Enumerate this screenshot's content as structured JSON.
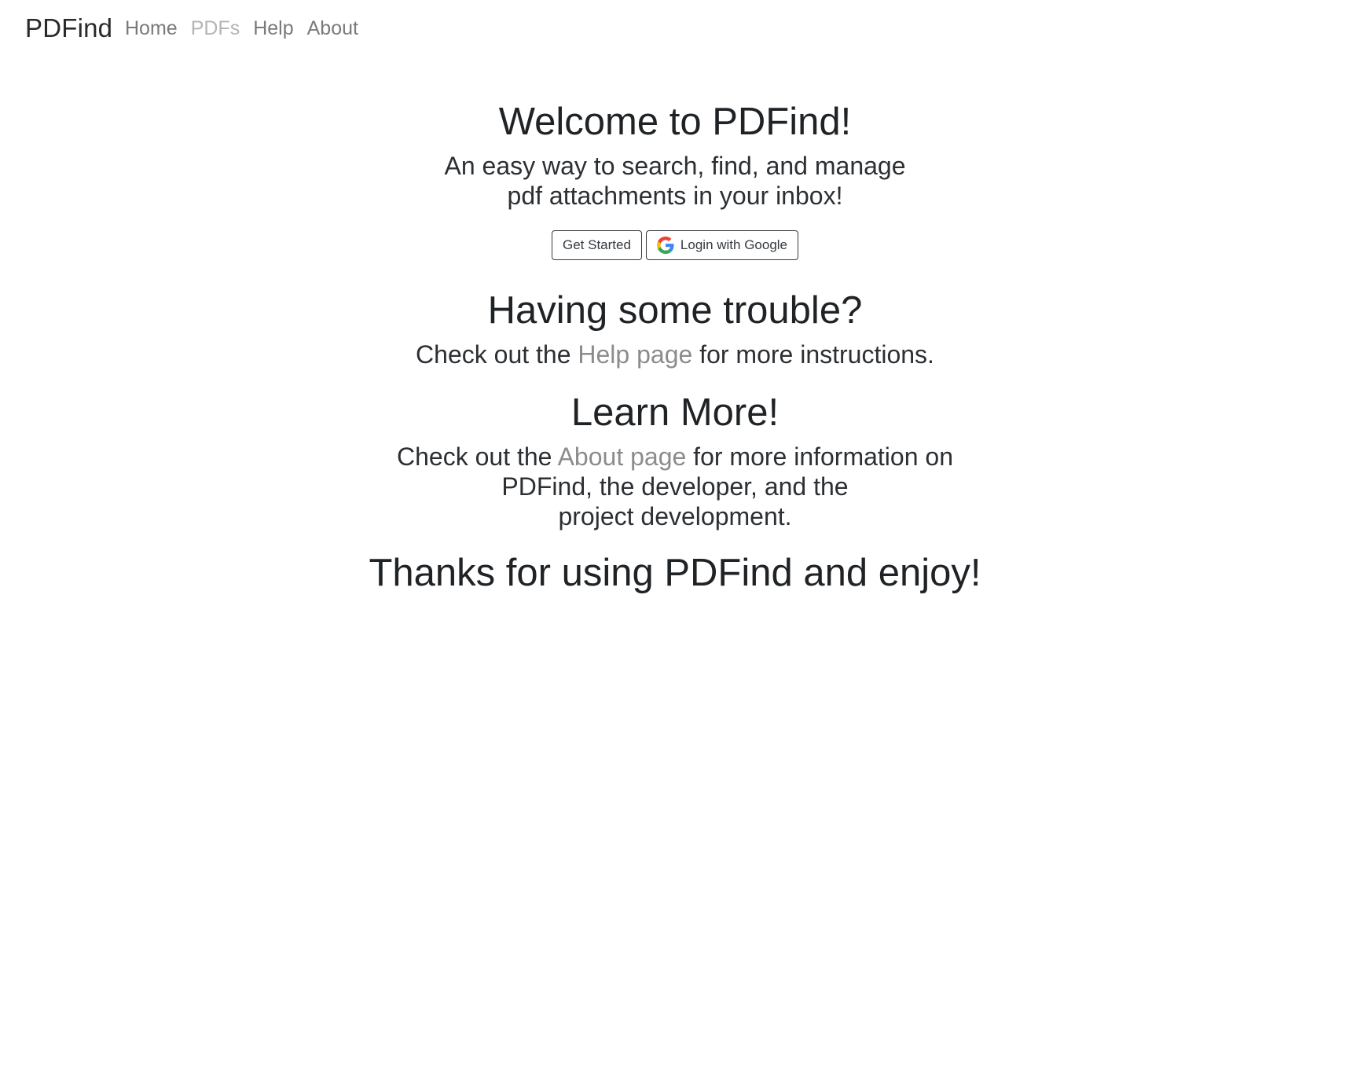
{
  "navbar": {
    "brand": "PDFind",
    "links": [
      {
        "label": "Home"
      },
      {
        "label": "PDFs"
      },
      {
        "label": "Help"
      },
      {
        "label": "About"
      }
    ]
  },
  "hero": {
    "title": "Welcome to PDFind!",
    "tagline_line1": "An easy way to search, find, and manage",
    "tagline_line2": "pdf attachments in your inbox!",
    "get_started_label": "Get Started",
    "google_login_label": "Login with Google"
  },
  "help_section": {
    "title": "Having some trouble?",
    "text_before": "Check out the ",
    "link_text": "Help page",
    "text_after": " for more instructions."
  },
  "about_section": {
    "title": "Learn More!",
    "text_before": "Check out the ",
    "link_text": "About page",
    "text_after_line1": " for more information on",
    "text_line2": "PDFind, the developer, and the",
    "text_line3": "project development."
  },
  "closing": {
    "title": "Thanks for using PDFind and enjoy!"
  },
  "colors": {
    "text": "#212529",
    "link_muted": "#8c8c8c",
    "nav_link": "#7a7a7a",
    "nav_link_disabled": "#b4b4b4",
    "google_blue": "#4285F4",
    "google_red": "#EA4335",
    "google_yellow": "#FBBC05",
    "google_green": "#34A853"
  },
  "icons": {
    "google": "google-g-icon"
  }
}
